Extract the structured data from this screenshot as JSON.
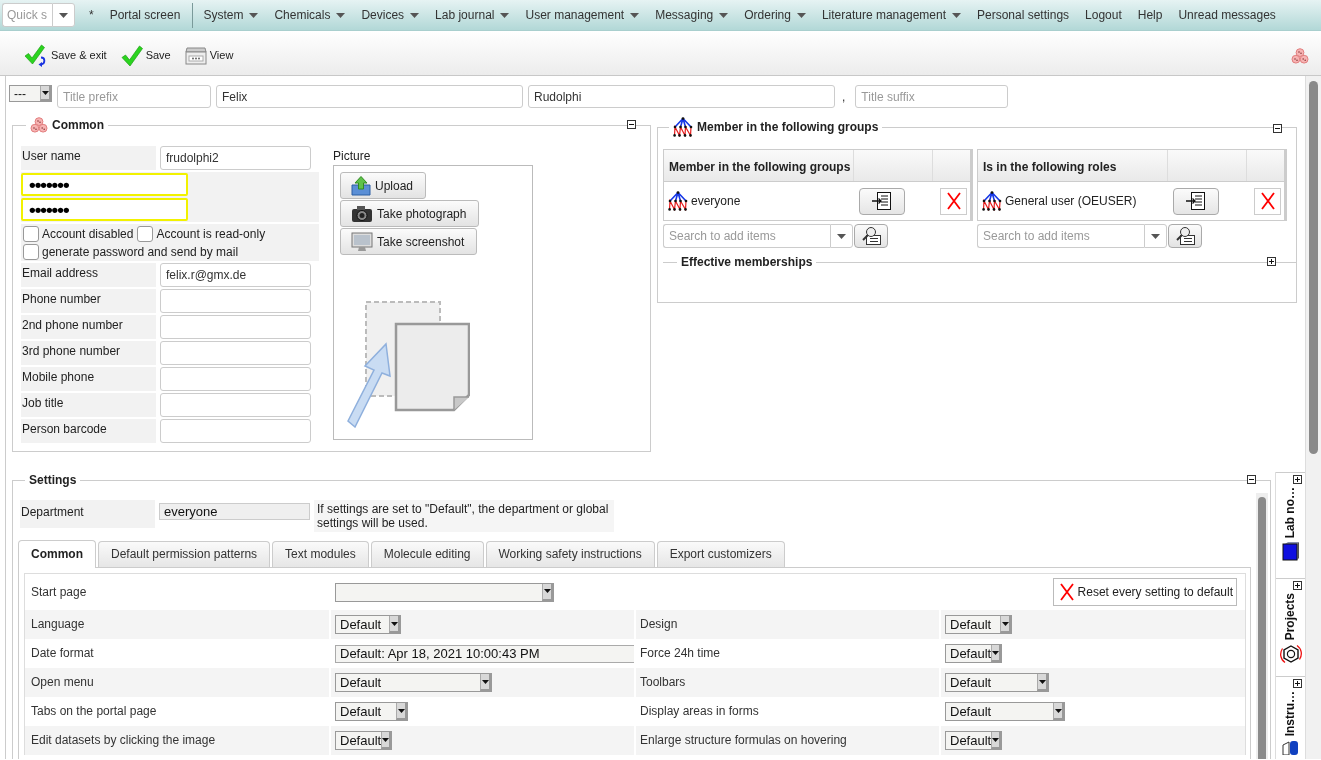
{
  "nav": {
    "quick_search": {
      "placeholder": "Quick s"
    },
    "links": [
      "*",
      "Portal screen"
    ],
    "menus": [
      {
        "label": "System",
        "dropdown": true
      },
      {
        "label": "Chemicals",
        "dropdown": true
      },
      {
        "label": "Devices",
        "dropdown": true
      },
      {
        "label": "Lab journal",
        "dropdown": true
      },
      {
        "label": "User management",
        "dropdown": true
      },
      {
        "label": "Messaging",
        "dropdown": true
      },
      {
        "label": "Ordering",
        "dropdown": true
      },
      {
        "label": "Literature management",
        "dropdown": true
      },
      {
        "label": "Personal settings",
        "dropdown": false
      },
      {
        "label": "Logout",
        "dropdown": false
      },
      {
        "label": "Help",
        "dropdown": false
      },
      {
        "label": "Unread messages",
        "dropdown": false
      }
    ]
  },
  "toolbar": {
    "buttons": [
      {
        "kind": "save_exit",
        "label": "Save & exit"
      },
      {
        "kind": "save",
        "label": "Save"
      },
      {
        "kind": "view",
        "label": "View"
      }
    ]
  },
  "name_row": {
    "salutation": "---",
    "title_prefix": {
      "placeholder": "Title prefix"
    },
    "first_name": "Felix",
    "last_name": "Rudolphi",
    "separator": ",",
    "title_suffix": {
      "placeholder": "Title suffix"
    }
  },
  "common": {
    "title": "Common",
    "expanded": true,
    "user_name": {
      "label": "User name",
      "value": "frudolphi2"
    },
    "passwords": [
      {
        "value": "•••••••",
        "highlighted": true
      },
      {
        "value": "•••••••",
        "highlighted": true
      }
    ],
    "checkboxes": [
      {
        "label": "Account disabled",
        "checked": false
      },
      {
        "label": "Account is read-only",
        "checked": false
      },
      {
        "label": "generate password and send by mail",
        "checked": false
      }
    ],
    "fields": [
      {
        "label": "Email address",
        "value": "felix.r@gmx.de"
      },
      {
        "label": "Phone number"
      },
      {
        "label": "2nd phone number"
      },
      {
        "label": "3rd phone number"
      },
      {
        "label": "Mobile phone"
      },
      {
        "label": "Job title"
      },
      {
        "label": "Person barcode"
      }
    ],
    "picture": {
      "label": "Picture",
      "buttons": [
        {
          "kind": "upload",
          "label": "Upload"
        },
        {
          "kind": "photo",
          "label": "Take photograph"
        },
        {
          "kind": "screenshot",
          "label": "Take screenshot"
        }
      ]
    }
  },
  "memberships": {
    "title": "Member in the following groups",
    "expanded": true,
    "tables": [
      {
        "heading": "Member in the following groups",
        "rows": [
          {
            "name": "everyone"
          }
        ],
        "search": {
          "placeholder": "Search to add items"
        }
      },
      {
        "heading": "Is in the following roles",
        "rows": [
          {
            "name": "General user (OEUSER)"
          }
        ],
        "search": {
          "placeholder": "Search to add items"
        }
      }
    ],
    "effective": {
      "title": "Effective memberships",
      "expanded": false
    }
  },
  "settings": {
    "title": "Settings",
    "expanded": true,
    "department": {
      "label": "Department",
      "value": "everyone",
      "note": "If settings are set to \"Default\", the department or global settings will be used."
    },
    "tabs": [
      {
        "label": "Common",
        "selected": true
      },
      {
        "label": "Default permission patterns",
        "selected": false
      },
      {
        "label": "Text modules",
        "selected": false
      },
      {
        "label": "Molecule editing",
        "selected": false
      },
      {
        "label": "Working safety instructions",
        "selected": false
      },
      {
        "label": "Export customizers",
        "selected": false
      }
    ],
    "reset_button": "Reset every setting to default",
    "rows": [
      {
        "left": {
          "label": "Start page",
          "kind": "select"
        }
      },
      {
        "left": {
          "label": "Language",
          "kind": "select",
          "value": "Default"
        },
        "right": {
          "label": "Design",
          "kind": "select",
          "value": "Default"
        }
      },
      {
        "left": {
          "label": "Date format",
          "kind": "text",
          "value": "Default: Apr 18, 2021 10:00:43 PM"
        },
        "right": {
          "label": "Force 24h time",
          "kind": "select",
          "value": "Default"
        }
      },
      {
        "left": {
          "label": "Open menu",
          "kind": "select",
          "value": "Default"
        },
        "right": {
          "label": "Toolbars",
          "kind": "select",
          "value": "Default"
        }
      },
      {
        "left": {
          "label": "Tabs on the portal page",
          "kind": "select",
          "value": "Default"
        },
        "right": {
          "label": "Display areas in forms",
          "kind": "select",
          "value": "Default"
        }
      },
      {
        "left": {
          "label": "Edit datasets by clicking the image",
          "kind": "select",
          "value": "Default"
        },
        "right": {
          "label": "Enlarge structure formulas on hovering",
          "kind": "select",
          "value": "Default"
        }
      }
    ]
  },
  "side_tabs": [
    {
      "label": "Lab no…",
      "kind": "notebook",
      "expanded": false
    },
    {
      "label": "Projects",
      "kind": "projects",
      "expanded": false
    },
    {
      "label": "Instru…",
      "kind": "instruments",
      "expanded": false
    }
  ]
}
